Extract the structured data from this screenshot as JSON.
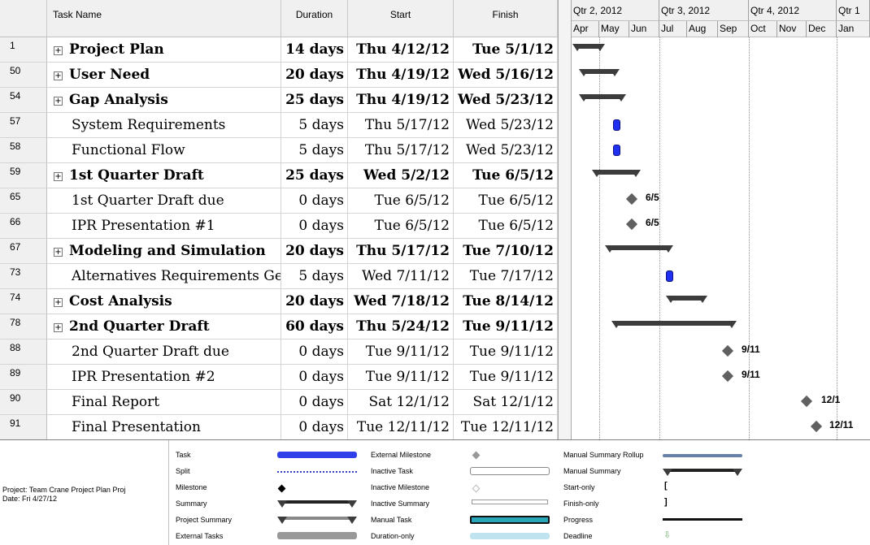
{
  "header": {
    "task_name": "Task Name",
    "duration": "Duration",
    "start": "Start",
    "finish": "Finish"
  },
  "timescale": {
    "quarters": [
      "Qtr 2, 2012",
      "Qtr 3, 2012",
      "Qtr 4, 2012",
      "Qtr 1"
    ],
    "months": [
      "Apr",
      "May",
      "Jun",
      "Jul",
      "Aug",
      "Sep",
      "Oct",
      "Nov",
      "Dec",
      "Jan"
    ]
  },
  "rows": [
    {
      "id": "1",
      "name": "Project Plan",
      "duration": "14 days",
      "start": "Thu 4/12/12",
      "finish": "Tue 5/1/12",
      "summary": true
    },
    {
      "id": "50",
      "name": "User Need",
      "duration": "20 days",
      "start": "Thu 4/19/12",
      "finish": "Wed 5/16/12",
      "summary": true
    },
    {
      "id": "54",
      "name": "Gap Analysis",
      "duration": "25 days",
      "start": "Thu 4/19/12",
      "finish": "Wed 5/23/12",
      "summary": true
    },
    {
      "id": "57",
      "name": "System Requirements",
      "duration": "5 days",
      "start": "Thu 5/17/12",
      "finish": "Wed 5/23/12",
      "summary": false
    },
    {
      "id": "58",
      "name": "Functional Flow",
      "duration": "5 days",
      "start": "Thu 5/17/12",
      "finish": "Wed 5/23/12",
      "summary": false
    },
    {
      "id": "59",
      "name": "1st Quarter Draft",
      "duration": "25 days",
      "start": "Wed 5/2/12",
      "finish": "Tue 6/5/12",
      "summary": true
    },
    {
      "id": "65",
      "name": "1st Quarter Draft due",
      "duration": "0 days",
      "start": "Tue 6/5/12",
      "finish": "Tue 6/5/12",
      "summary": false
    },
    {
      "id": "66",
      "name": "IPR Presentation #1",
      "duration": "0 days",
      "start": "Tue 6/5/12",
      "finish": "Tue 6/5/12",
      "summary": false
    },
    {
      "id": "67",
      "name": "Modeling and Simulation",
      "duration": "20 days",
      "start": "Thu 5/17/12",
      "finish": "Tue 7/10/12",
      "summary": true
    },
    {
      "id": "73",
      "name": "Alternatives Requirements Gen",
      "duration": "5 days",
      "start": "Wed 7/11/12",
      "finish": "Tue 7/17/12",
      "summary": false
    },
    {
      "id": "74",
      "name": "Cost Analysis",
      "duration": "20 days",
      "start": "Wed 7/18/12",
      "finish": "Tue 8/14/12",
      "summary": true
    },
    {
      "id": "78",
      "name": "2nd Quarter Draft",
      "duration": "60 days",
      "start": "Thu 5/24/12",
      "finish": "Tue 9/11/12",
      "summary": true
    },
    {
      "id": "88",
      "name": "2nd Quarter Draft due",
      "duration": "0 days",
      "start": "Tue 9/11/12",
      "finish": "Tue 9/11/12",
      "summary": false
    },
    {
      "id": "89",
      "name": "IPR Presentation #2",
      "duration": "0 days",
      "start": "Tue 9/11/12",
      "finish": "Tue 9/11/12",
      "summary": false
    },
    {
      "id": "90",
      "name": "Final Report",
      "duration": "0 days",
      "start": "Sat 12/1/12",
      "finish": "Sat 12/1/12",
      "summary": false
    },
    {
      "id": "91",
      "name": "Final Presentation",
      "duration": "0 days",
      "start": "Tue 12/11/12",
      "finish": "Tue 12/11/12",
      "summary": false
    }
  ],
  "milestone_labels": {
    "r65": "6/5",
    "r66": "6/5",
    "r88": "9/11",
    "r89": "9/11",
    "r90": "12/1",
    "r91": "12/11"
  },
  "legend": {
    "project_line1": "Project: Team Crane Project Plan Proj",
    "project_line2": "Date: Fri 4/27/12",
    "col1": [
      "Task",
      "Split",
      "Milestone",
      "Summary",
      "Project Summary",
      "External Tasks"
    ],
    "col2": [
      "External Milestone",
      "Inactive Task",
      "Inactive Milestone",
      "Inactive Summary",
      "Manual Task",
      "Duration-only"
    ],
    "col3": [
      "Manual Summary Rollup",
      "Manual Summary",
      "Start-only",
      "Finish-only",
      "Progress",
      "Deadline"
    ],
    "start_only_glyph": "[",
    "finish_only_glyph": "]",
    "deadline_glyph": "⇩"
  },
  "colors": {
    "task": "#2030f0",
    "summary": "#3c3c3c",
    "milestone": "#606060",
    "manual_task": "#29a6b8"
  }
}
